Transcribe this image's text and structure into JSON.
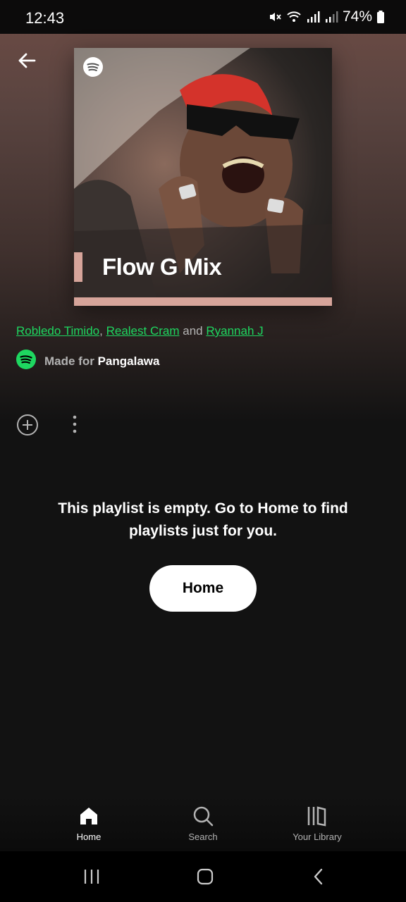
{
  "status_bar": {
    "time": "12:43",
    "battery": "74%"
  },
  "playlist": {
    "cover_title": "Flow G Mix",
    "artists": [
      "Robledo Timido",
      "Realest Cram",
      "Ryannah J"
    ],
    "artists_separator_1": ",",
    "artists_separator_2": "and",
    "made_for_prefix": "Made for",
    "made_for_user": "Pangalawa"
  },
  "empty_state": {
    "message": "This playlist is empty. Go to Home to find playlists just for you.",
    "button_label": "Home"
  },
  "bottom_nav": {
    "items": [
      {
        "label": "Home",
        "icon": "home-icon",
        "active": true
      },
      {
        "label": "Search",
        "icon": "search-icon",
        "active": false
      },
      {
        "label": "Your Library",
        "icon": "library-icon",
        "active": false
      }
    ]
  },
  "colors": {
    "accent": "#1ed760",
    "background": "#121212",
    "cover_accent": "#d6a49a"
  }
}
